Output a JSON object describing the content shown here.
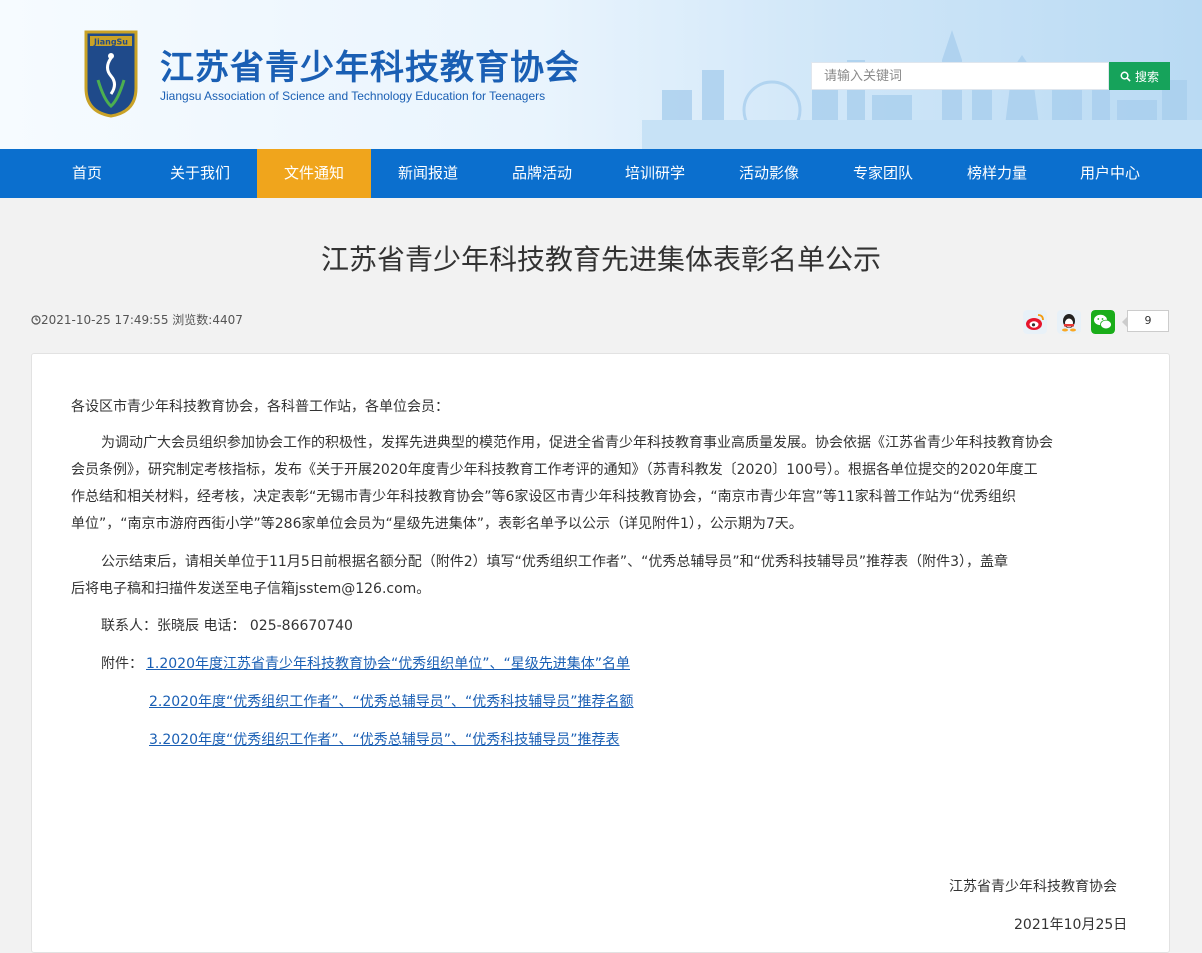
{
  "header": {
    "logo_text": "JiangSu",
    "title": "江苏省青少年科技教育协会",
    "subtitle": "Jiangsu Association of Science and Technology Education for Teenagers",
    "search_placeholder": "请输入关键词",
    "search_button": "搜索"
  },
  "nav": {
    "items": [
      "首页",
      "关于我们",
      "文件通知",
      "新闻报道",
      "品牌活动",
      "培训研学",
      "活动影像",
      "专家团队",
      "榜样力量",
      "用户中心"
    ],
    "active": "文件通知"
  },
  "article": {
    "title": "江苏省青少年科技教育先进集体表彰名单公示",
    "datetime": "2021-10-25 17:49:55",
    "views_label": "浏览数:4407",
    "share_count": "9",
    "salutation": "各设区市青少年科技教育协会，各科普工作站，各单位会员：",
    "para1_l1": "为调动广大会员组织参加协会工作的积极性，发挥先进典型的模范作用，促进全省青少年科技教育事业高质量发展。协会依据《江苏省青少年科技教育协会",
    "para1_l2": "会员条例》，研究制定考核指标，发布《关于开展2020年度青少年科技教育工作考评的通知》（苏青科教发〔2020〕100号）。根据各单位提交的2020年度工",
    "para1_l3": "作总结和相关材料，经考核，决定表彰“无锡市青少年科技教育协会”等6家设区市青少年科技教育协会，“南京市青少年宫”等11家科普工作站为“优秀组织",
    "para1_l4": "单位”，“南京市游府西街小学”等286家单位会员为“星级先进集体”，表彰名单予以公示（详见附件1），公示期为7天。",
    "para2_l1": "公示结束后，请相关单位于11月5日前根据名额分配（附件2）填写“优秀组织工作者”、“优秀总辅导员”和“优秀科技辅导员”推荐表（附件3），盖章",
    "para2_l2": "后将电子稿和扫描件发送至电子信箱jsstem@126.com。",
    "contact": "联系人：张晓辰  电话： 025-86670740",
    "attach_label": "附件：",
    "attachments": [
      "1.2020年度江苏省青少年科技教育协会“优秀组织单位”、“星级先进集体”名单",
      "2.2020年度“优秀组织工作者”、“优秀总辅导员”、“优秀科技辅导员”推荐名额",
      "3.2020年度“优秀组织工作者”、“优秀总辅导员”、“优秀科技辅导员”推荐表"
    ],
    "signature": "江苏省青少年科技教育协会",
    "date": "2021年10月25日"
  }
}
